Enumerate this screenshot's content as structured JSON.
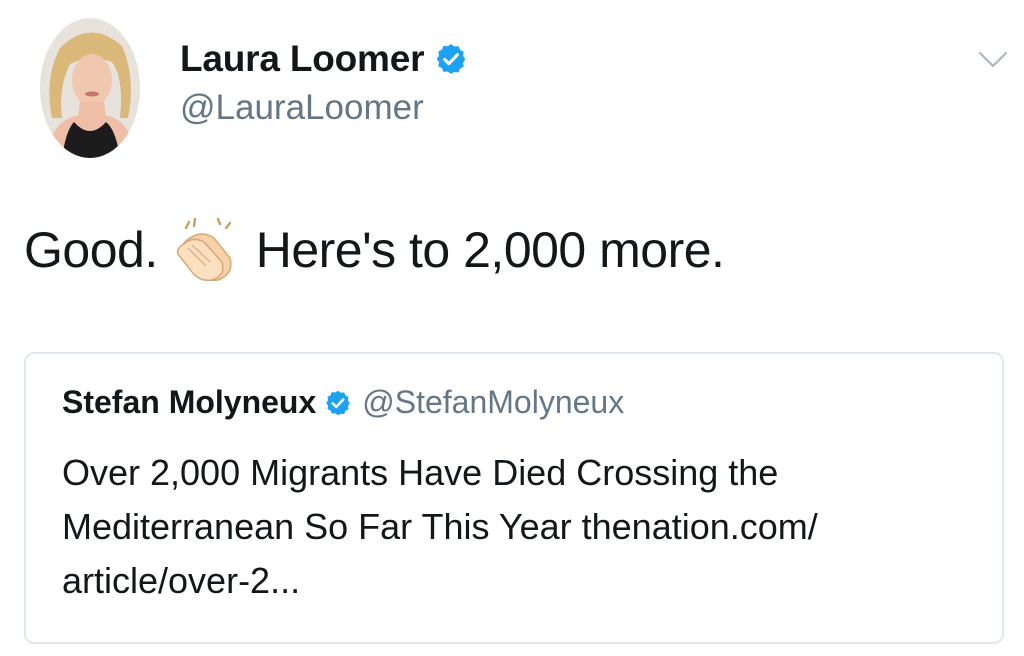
{
  "tweet": {
    "author": {
      "display_name": "Laura Loomer",
      "handle": "@LauraLoomer",
      "verified": true
    },
    "text_before": "Good.",
    "emoji": "clapping-hands",
    "text_after": "Here's to 2,000 more.",
    "quoted_tweet": {
      "display_name": "Stefan Molyneux",
      "handle": "@StefanMolyneux",
      "verified": true,
      "text": "Over 2,000 Migrants Have Died Crossing the\nMediterranean So Far This Year  thenation.com/\narticle/over-2..."
    }
  },
  "colors": {
    "verified_blue": "#1da1f2",
    "secondary_text": "#657786",
    "border": "#e1e8ed"
  },
  "icons": [
    "verified-badge-icon",
    "chevron-down-icon",
    "clapping-hands-emoji"
  ]
}
